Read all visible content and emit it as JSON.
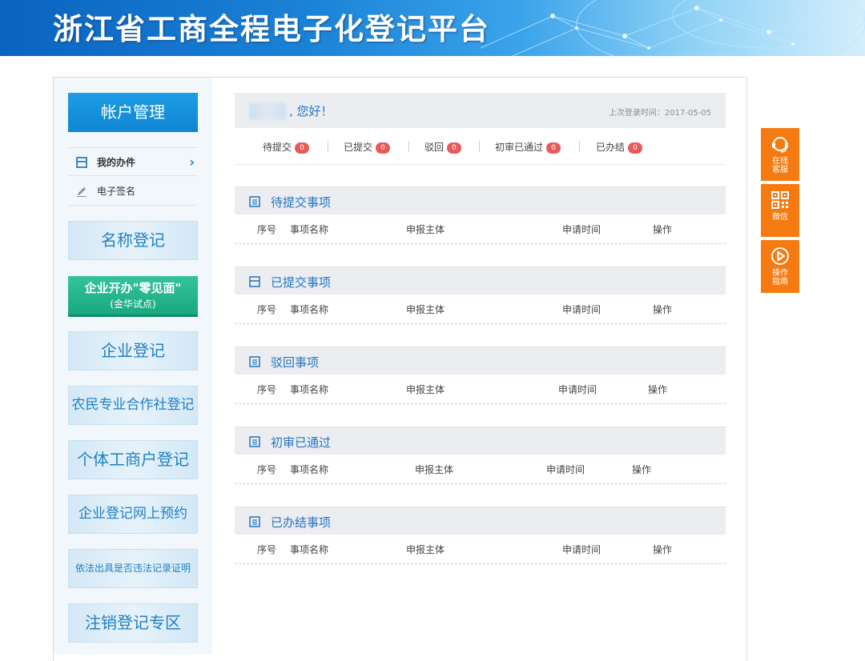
{
  "banner": {
    "title": "浙江省工商全程电子化登记平台"
  },
  "sidebar": {
    "header": "帐户管理",
    "items": [
      {
        "label": "我的办件",
        "icon": "document-icon"
      },
      {
        "label": "电子签名",
        "icon": "pen-icon"
      }
    ],
    "buttons": [
      {
        "label": "名称登记"
      },
      {
        "label_line1": "企业开办\"零见面\"",
        "label_line2": "(金华试点)"
      },
      {
        "label": "企业登记"
      },
      {
        "label": "农民专业合作社登记"
      },
      {
        "label": "个体工商户登记"
      },
      {
        "label": "企业登记网上预约"
      },
      {
        "label": "依法出具是否违法记录证明"
      },
      {
        "label": "注销登记专区"
      }
    ]
  },
  "welcome": {
    "greeting": ", 您好！",
    "last_login_label": "上次登录时间：",
    "last_login_date": "2017-05-05"
  },
  "stats": [
    {
      "label": "待提交",
      "count": "0"
    },
    {
      "label": "已提交",
      "count": "0"
    },
    {
      "label": "驳回",
      "count": "0"
    },
    {
      "label": "初审已通过",
      "count": "0"
    },
    {
      "label": "已办结",
      "count": "0"
    }
  ],
  "columns": {
    "index": "序号",
    "name": "事项名称",
    "subject": "申报主体",
    "time": "申请时间",
    "action": "操作"
  },
  "sections": [
    {
      "title": "待提交事项"
    },
    {
      "title": "已提交事项"
    },
    {
      "title": "驳回事项"
    },
    {
      "title": "初审已通过"
    },
    {
      "title": "已办结事项"
    }
  ],
  "float": [
    {
      "label_line1": "在线",
      "label_line2": "客服",
      "icon": "headset-icon"
    },
    {
      "label_line1": "微信",
      "label_line2": "",
      "icon": "qrcode-icon"
    },
    {
      "label_line1": "操作",
      "label_line2": "指南",
      "icon": "play-icon"
    }
  ],
  "colors": {
    "accent": "#1f7fc7",
    "orange": "#f47a11",
    "green": "#1fb084",
    "badge": "#e85a5a"
  }
}
